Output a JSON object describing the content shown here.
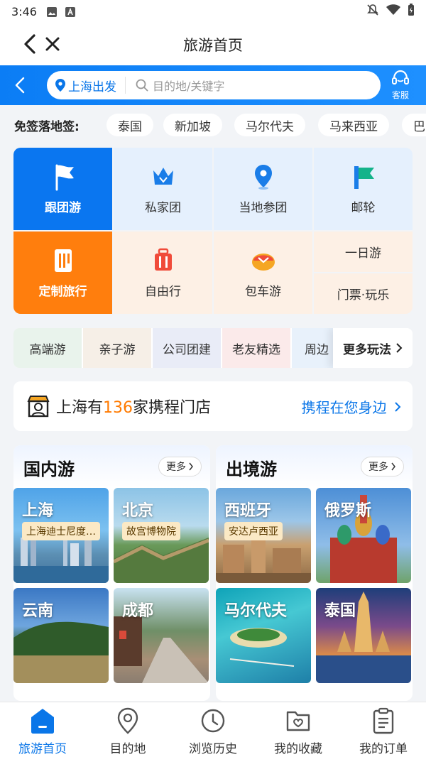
{
  "status": {
    "time": "3:46"
  },
  "header": {
    "title": "旅游首页"
  },
  "search": {
    "departure": "上海出发",
    "placeholder": "目的地/关键字",
    "service_label": "客服"
  },
  "visa": {
    "title": "免签落地签:",
    "chips": [
      "泰国",
      "新加坡",
      "马尔代夫",
      "马来西亚",
      "巴"
    ]
  },
  "categories": {
    "group_tour": "跟团游",
    "private_tour": "私家团",
    "local_tour": "当地参团",
    "cruise": "邮轮",
    "custom_trip": "定制旅行",
    "independent": "自由行",
    "charter_car": "包车游",
    "day_tour": "一日游",
    "tickets": "门票·玩乐"
  },
  "tags": {
    "items": [
      "高端游",
      "亲子游",
      "公司团建",
      "老友精选",
      "周边"
    ],
    "more": "更多玩法"
  },
  "store": {
    "prefix": "上海有",
    "count": "136",
    "suffix": "家携程门店",
    "link": "携程在您身边"
  },
  "domestic": {
    "title": "国内游",
    "more": "更多",
    "tiles": [
      {
        "name": "上海",
        "badge": "上海迪士尼度…"
      },
      {
        "name": "北京",
        "badge": "故宫博物院"
      },
      {
        "name": "云南",
        "badge": ""
      },
      {
        "name": "成都",
        "badge": ""
      }
    ]
  },
  "outbound": {
    "title": "出境游",
    "more": "更多",
    "tiles": [
      {
        "name": "西班牙",
        "badge": "安达卢西亚"
      },
      {
        "name": "俄罗斯",
        "badge": ""
      },
      {
        "name": "马尔代夫",
        "badge": ""
      },
      {
        "name": "泰国",
        "badge": ""
      }
    ]
  },
  "nav": {
    "home": "旅游首页",
    "destination": "目的地",
    "history": "浏览历史",
    "favorites": "我的收藏",
    "orders": "我的订单"
  },
  "colors": {
    "brand_blue": "#0a76e8",
    "orange": "#ff7a00"
  }
}
